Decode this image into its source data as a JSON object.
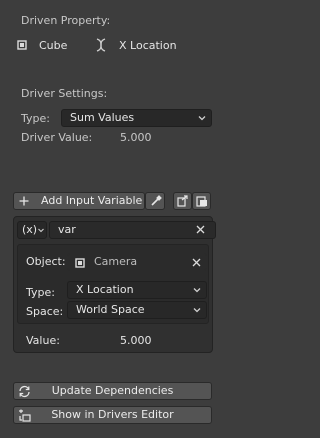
{
  "driven_property": {
    "heading": "Driven Property:",
    "object_name": "Cube",
    "property_name": "X Location",
    "object_icon": "object-cube-icon",
    "property_icon": "dna-fcurve-icon"
  },
  "driver_settings": {
    "heading": "Driver Settings:",
    "type_label": "Type:",
    "type_value": "Sum Values",
    "value_label": "Driver Value:",
    "value": "5.000"
  },
  "toolbar": {
    "add_variable_label": "Add Input Variable",
    "add_icon": "plus-icon",
    "eyedropper_icon": "eyedropper-icon",
    "copy_icon": "copy-variables-icon",
    "paste_icon": "paste-variables-icon"
  },
  "variable": {
    "type_button_label": "(x)",
    "name": "var",
    "remove_icon": "close-icon",
    "object_label": "Object:",
    "object_value": "Camera",
    "type_label": "Type:",
    "type_value": "X Location",
    "space_label": "Space:",
    "space_value": "World Space",
    "value_label": "Value:",
    "value": "5.000"
  },
  "footer": {
    "update_label": "Update Dependencies",
    "show_editor_label": "Show in Drivers Editor",
    "update_icon": "refresh-icon",
    "editor_icon": "drivers-editor-icon"
  },
  "colors": {
    "background": "#3d3d3d",
    "field": "#282828",
    "button": "#545454",
    "text": "#e6e6e6"
  }
}
